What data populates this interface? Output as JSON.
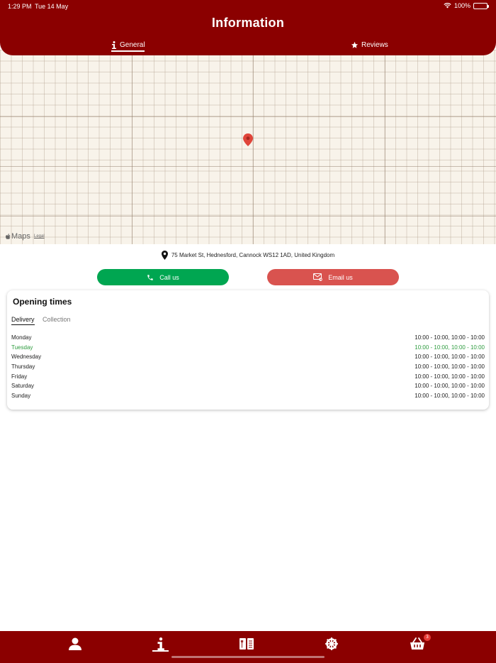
{
  "status_bar": {
    "time": "1:29 PM",
    "date": "Tue 14 May",
    "battery": "100%"
  },
  "header": {
    "title": "Information"
  },
  "tabs": [
    {
      "label": "General",
      "active": true
    },
    {
      "label": "Reviews",
      "active": false
    }
  ],
  "map": {
    "brand": "Maps",
    "legal": "Legal"
  },
  "address": "75 Market St, Hednesford, Cannock WS12 1AD, United Kingdom",
  "buttons": {
    "call": "Call us",
    "email": "Email us"
  },
  "opening_times": {
    "title": "Opening times",
    "sub_tabs": [
      {
        "label": "Delivery",
        "active": true
      },
      {
        "label": "Collection",
        "active": false
      }
    ],
    "days": [
      {
        "day": "Monday",
        "hours": "10:00 - 10:00, 10:00 - 10:00"
      },
      {
        "day": "Tuesday",
        "hours": "10:00 - 10:00, 10:00 - 10:00"
      },
      {
        "day": "Wednesday",
        "hours": "10:00 - 10:00, 10:00 - 10:00"
      },
      {
        "day": "Thursday",
        "hours": "10:00 - 10:00, 10:00 - 10:00"
      },
      {
        "day": "Friday",
        "hours": "10:00 - 10:00, 10:00 - 10:00"
      },
      {
        "day": "Saturday",
        "hours": "10:00 - 10:00, 10:00 - 10:00"
      },
      {
        "day": "Sunday",
        "hours": "10:00 - 10:00, 10:00 - 10:00"
      }
    ]
  },
  "bottom_nav": {
    "items": [
      {
        "icon": "user-icon"
      },
      {
        "icon": "info-icon",
        "active": true
      },
      {
        "icon": "menu-book-icon"
      },
      {
        "icon": "settings-wheel-icon"
      },
      {
        "icon": "basket-icon"
      }
    ],
    "cart_count": "3"
  },
  "colors": {
    "brand": "#8b0000",
    "call": "#00a651",
    "email": "#d9534f",
    "today": "#2e9c3f"
  }
}
